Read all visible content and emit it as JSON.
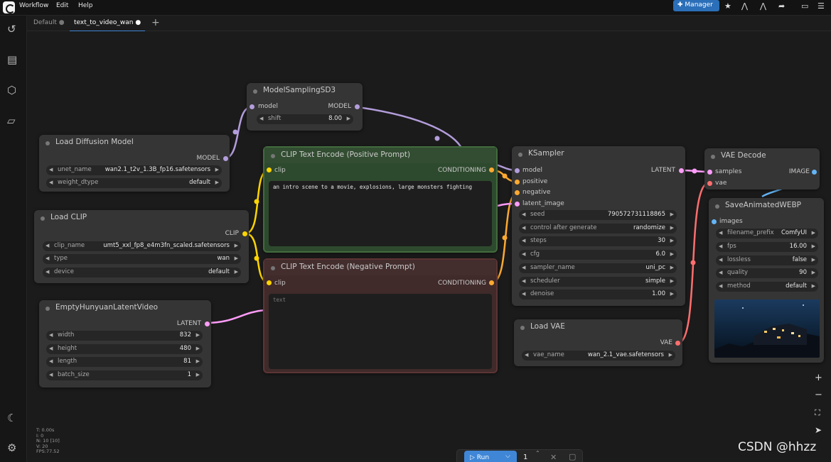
{
  "menu": {
    "workflow": "Workflow",
    "edit": "Edit",
    "help": "Help"
  },
  "topbar": {
    "manager": "Manager"
  },
  "tabs": [
    {
      "label": "Default",
      "active": false
    },
    {
      "label": "text_to_video_wan",
      "active": true
    }
  ],
  "nodes": {
    "model_sampling": {
      "title": "ModelSamplingSD3",
      "in": "model",
      "out": "MODEL",
      "shift_label": "shift",
      "shift_value": "8.00"
    },
    "load_diffusion": {
      "title": "Load Diffusion Model",
      "out": "MODEL",
      "unet_label": "unet_name",
      "unet_value": "wan2.1_t2v_1.3B_fp16.safetensors",
      "dtype_label": "weight_dtype",
      "dtype_value": "default"
    },
    "load_clip": {
      "title": "Load CLIP",
      "out": "CLIP",
      "clip_label": "clip_name",
      "clip_value": "umt5_xxl_fp8_e4m3fn_scaled.safetensors",
      "type_label": "type",
      "type_value": "wan",
      "device_label": "device",
      "device_value": "default"
    },
    "clip_pos": {
      "title": "CLIP Text Encode (Positive Prompt)",
      "in": "clip",
      "out": "CONDITIONING",
      "text": "an intro scene to a movie, explosions, large monsters fighting"
    },
    "clip_neg": {
      "title": "CLIP Text Encode (Negative Prompt)",
      "in": "clip",
      "out": "CONDITIONING",
      "placeholder": "text"
    },
    "latent": {
      "title": "EmptyHunyuanLatentVideo",
      "out": "LATENT",
      "width_label": "width",
      "width_value": "832",
      "height_label": "height",
      "height_value": "480",
      "length_label": "length",
      "length_value": "81",
      "batch_label": "batch_size",
      "batch_value": "1"
    },
    "ksampler": {
      "title": "KSampler",
      "in_model": "model",
      "in_pos": "positive",
      "in_neg": "negative",
      "in_latent": "latent_image",
      "out": "LATENT",
      "seed_label": "seed",
      "seed_value": "790572731118865",
      "cag_label": "control after generate",
      "cag_value": "randomize",
      "steps_label": "steps",
      "steps_value": "30",
      "cfg_label": "cfg",
      "cfg_value": "6.0",
      "sampler_label": "sampler_name",
      "sampler_value": "uni_pc",
      "sched_label": "scheduler",
      "sched_value": "simple",
      "denoise_label": "denoise",
      "denoise_value": "1.00"
    },
    "vae_decode": {
      "title": "VAE Decode",
      "in_samples": "samples",
      "in_vae": "vae",
      "out": "IMAGE"
    },
    "save_webp": {
      "title": "SaveAnimatedWEBP",
      "in": "images",
      "prefix_label": "filename_prefix",
      "prefix_value": "ComfyUI",
      "fps_label": "fps",
      "fps_value": "16.00",
      "lossless_label": "lossless",
      "lossless_value": "false",
      "quality_label": "quality",
      "quality_value": "90",
      "method_label": "method",
      "method_value": "default"
    },
    "load_vae": {
      "title": "Load VAE",
      "out": "VAE",
      "vae_label": "vae_name",
      "vae_value": "wan_2.1_vae.safetensors"
    }
  },
  "stats": [
    "T: 0.00s",
    "I: 0",
    "N: 10 [10]",
    "V: 20",
    "FPS:77.52"
  ],
  "run": {
    "label": "Run",
    "count": "1"
  },
  "watermark": "CSDN @hhzz",
  "colors": {
    "accent": "#3f86d6",
    "model": "#b39ddb",
    "clip": "#ffd500",
    "conditioning": "#ffa931",
    "latent": "#ff9cf9",
    "vae": "#ff6e6e",
    "image": "#64b5f6"
  }
}
